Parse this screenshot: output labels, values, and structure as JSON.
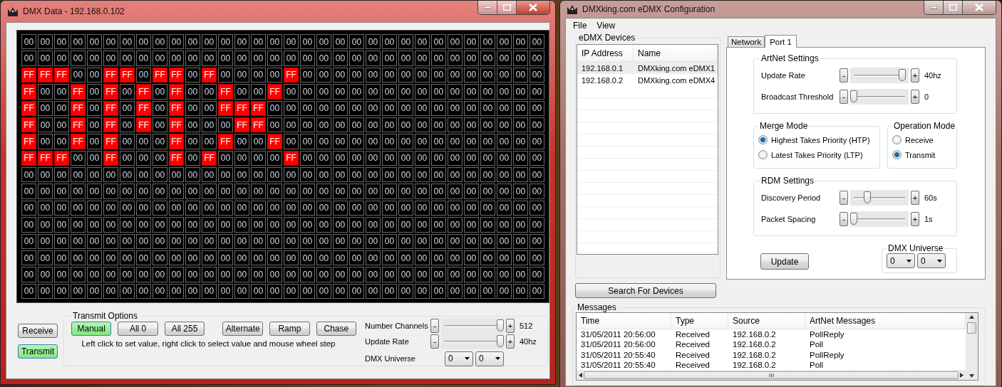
{
  "dmx_window": {
    "title": "DMX Data - 192.168.0.102",
    "grid": {
      "rows": [
        {
          "values": [
            "00",
            "00",
            "00",
            "00",
            "00",
            "00",
            "00",
            "00",
            "00",
            "00",
            "00",
            "00",
            "00",
            "00",
            "00",
            "00",
            "00",
            "00",
            "00",
            "00",
            "00",
            "00",
            "00",
            "00",
            "00",
            "00",
            "00",
            "00",
            "00",
            "00",
            "00",
            "00"
          ],
          "lit": [
            false,
            false,
            false,
            false,
            false,
            false,
            false,
            false,
            false,
            false,
            false,
            false,
            false,
            false,
            false,
            false,
            false,
            false,
            false,
            false,
            false,
            false,
            false,
            false,
            false,
            false,
            false,
            false,
            false,
            false,
            false,
            false
          ]
        },
        {
          "values": [
            "00",
            "00",
            "00",
            "00",
            "00",
            "00",
            "00",
            "00",
            "00",
            "00",
            "00",
            "00",
            "00",
            "00",
            "00",
            "00",
            "00",
            "00",
            "00",
            "00",
            "00",
            "00",
            "00",
            "00",
            "00",
            "00",
            "00",
            "00",
            "00",
            "00",
            "00",
            "00"
          ],
          "lit": [
            false,
            false,
            false,
            false,
            false,
            false,
            false,
            false,
            false,
            false,
            false,
            false,
            false,
            false,
            false,
            false,
            false,
            false,
            false,
            false,
            false,
            false,
            false,
            false,
            false,
            false,
            false,
            false,
            false,
            false,
            false,
            false
          ]
        },
        {
          "values": [
            "FF",
            "FF",
            "FF",
            "00",
            "00",
            "FF",
            "FF",
            "00",
            "FF",
            "FF",
            "00",
            "FF",
            "00",
            "00",
            "00",
            "00",
            "FF",
            "00",
            "00",
            "00",
            "00",
            "00",
            "00",
            "00",
            "00",
            "00",
            "00",
            "00",
            "00",
            "00",
            "00",
            "00"
          ],
          "lit": [
            true,
            true,
            true,
            false,
            false,
            true,
            true,
            false,
            true,
            true,
            false,
            true,
            false,
            false,
            false,
            false,
            true,
            false,
            false,
            false,
            false,
            false,
            false,
            false,
            false,
            false,
            false,
            false,
            false,
            false,
            false,
            false
          ]
        },
        {
          "values": [
            "FF",
            "00",
            "00",
            "FF",
            "00",
            "FF",
            "00",
            "FF",
            "00",
            "FF",
            "00",
            "00",
            "FF",
            "00",
            "00",
            "FF",
            "00",
            "00",
            "00",
            "00",
            "00",
            "00",
            "00",
            "00",
            "00",
            "00",
            "00",
            "00",
            "00",
            "00",
            "00",
            "00"
          ],
          "lit": [
            true,
            false,
            false,
            true,
            false,
            true,
            false,
            true,
            false,
            true,
            false,
            false,
            true,
            false,
            false,
            true,
            false,
            false,
            false,
            false,
            false,
            false,
            false,
            false,
            false,
            false,
            false,
            false,
            false,
            false,
            false,
            false
          ]
        },
        {
          "values": [
            "FF",
            "00",
            "00",
            "FF",
            "00",
            "FF",
            "00",
            "FF",
            "00",
            "FF",
            "00",
            "00",
            "FF",
            "FF",
            "FF",
            "00",
            "00",
            "00",
            "00",
            "00",
            "00",
            "00",
            "00",
            "00",
            "00",
            "00",
            "00",
            "00",
            "00",
            "00",
            "00",
            "00"
          ],
          "lit": [
            true,
            false,
            false,
            true,
            false,
            true,
            false,
            true,
            false,
            true,
            false,
            false,
            true,
            true,
            true,
            false,
            false,
            false,
            false,
            false,
            false,
            false,
            false,
            false,
            false,
            false,
            false,
            false,
            false,
            false,
            false,
            false
          ]
        },
        {
          "values": [
            "FF",
            "00",
            "00",
            "FF",
            "00",
            "FF",
            "00",
            "FF",
            "00",
            "FF",
            "00",
            "00",
            "00",
            "FF",
            "FF",
            "00",
            "00",
            "00",
            "00",
            "00",
            "00",
            "00",
            "00",
            "00",
            "00",
            "00",
            "00",
            "00",
            "00",
            "00",
            "00",
            "00"
          ],
          "lit": [
            true,
            false,
            false,
            true,
            false,
            true,
            false,
            true,
            false,
            true,
            false,
            false,
            false,
            true,
            true,
            false,
            false,
            false,
            false,
            false,
            false,
            false,
            false,
            false,
            false,
            false,
            false,
            false,
            false,
            false,
            false,
            false
          ]
        },
        {
          "values": [
            "FF",
            "00",
            "00",
            "FF",
            "00",
            "FF",
            "00",
            "00",
            "00",
            "FF",
            "00",
            "00",
            "FF",
            "00",
            "00",
            "FF",
            "00",
            "00",
            "00",
            "00",
            "00",
            "00",
            "00",
            "00",
            "00",
            "00",
            "00",
            "00",
            "00",
            "00",
            "00",
            "00"
          ],
          "lit": [
            true,
            false,
            false,
            true,
            false,
            true,
            false,
            false,
            false,
            true,
            false,
            false,
            true,
            false,
            false,
            true,
            false,
            false,
            false,
            false,
            false,
            false,
            false,
            false,
            false,
            false,
            false,
            false,
            false,
            false,
            false,
            false
          ]
        },
        {
          "values": [
            "FF",
            "FF",
            "FF",
            "00",
            "00",
            "FF",
            "00",
            "00",
            "00",
            "FF",
            "00",
            "FF",
            "00",
            "00",
            "00",
            "00",
            "FF",
            "00",
            "00",
            "00",
            "00",
            "00",
            "00",
            "00",
            "00",
            "00",
            "00",
            "00",
            "00",
            "00",
            "00",
            "00"
          ],
          "lit": [
            true,
            true,
            true,
            false,
            false,
            true,
            false,
            false,
            false,
            true,
            false,
            true,
            false,
            false,
            false,
            false,
            true,
            false,
            false,
            false,
            false,
            false,
            false,
            false,
            false,
            false,
            false,
            false,
            false,
            false,
            false,
            false
          ]
        },
        {
          "values": [
            "00",
            "00",
            "00",
            "00",
            "00",
            "00",
            "00",
            "00",
            "00",
            "00",
            "00",
            "00",
            "00",
            "00",
            "00",
            "00",
            "00",
            "00",
            "00",
            "00",
            "00",
            "00",
            "00",
            "00",
            "00",
            "00",
            "00",
            "00",
            "00",
            "00",
            "00",
            "00"
          ],
          "lit": [
            false,
            false,
            false,
            false,
            false,
            false,
            false,
            false,
            false,
            false,
            false,
            false,
            false,
            false,
            false,
            false,
            false,
            false,
            false,
            false,
            false,
            false,
            false,
            false,
            false,
            false,
            false,
            false,
            false,
            false,
            false,
            false
          ]
        },
        {
          "values": [
            "00",
            "00",
            "00",
            "00",
            "00",
            "00",
            "00",
            "00",
            "00",
            "00",
            "00",
            "00",
            "00",
            "00",
            "00",
            "00",
            "00",
            "00",
            "00",
            "00",
            "00",
            "00",
            "00",
            "00",
            "00",
            "00",
            "00",
            "00",
            "00",
            "00",
            "00",
            "00"
          ],
          "lit": [
            false,
            false,
            false,
            false,
            false,
            false,
            false,
            false,
            false,
            false,
            false,
            false,
            false,
            false,
            false,
            false,
            false,
            false,
            false,
            false,
            false,
            false,
            false,
            false,
            false,
            false,
            false,
            false,
            false,
            false,
            false,
            false
          ]
        },
        {
          "values": [
            "00",
            "00",
            "00",
            "00",
            "00",
            "00",
            "00",
            "00",
            "00",
            "00",
            "00",
            "00",
            "00",
            "00",
            "00",
            "00",
            "00",
            "00",
            "00",
            "00",
            "00",
            "00",
            "00",
            "00",
            "00",
            "00",
            "00",
            "00",
            "00",
            "00",
            "00",
            "00"
          ],
          "lit": [
            false,
            false,
            false,
            false,
            false,
            false,
            false,
            false,
            false,
            false,
            false,
            false,
            false,
            false,
            false,
            false,
            false,
            false,
            false,
            false,
            false,
            false,
            false,
            false,
            false,
            false,
            false,
            false,
            false,
            false,
            false,
            false
          ]
        },
        {
          "values": [
            "00",
            "00",
            "00",
            "00",
            "00",
            "00",
            "00",
            "00",
            "00",
            "00",
            "00",
            "00",
            "00",
            "00",
            "00",
            "00",
            "00",
            "00",
            "00",
            "00",
            "00",
            "00",
            "00",
            "00",
            "00",
            "00",
            "00",
            "00",
            "00",
            "00",
            "00",
            "00"
          ],
          "lit": [
            false,
            false,
            false,
            false,
            false,
            false,
            false,
            false,
            false,
            false,
            false,
            false,
            false,
            false,
            false,
            false,
            false,
            false,
            false,
            false,
            false,
            false,
            false,
            false,
            false,
            false,
            false,
            false,
            false,
            false,
            false,
            false
          ]
        },
        {
          "values": [
            "00",
            "00",
            "00",
            "00",
            "00",
            "00",
            "00",
            "00",
            "00",
            "00",
            "00",
            "00",
            "00",
            "00",
            "00",
            "00",
            "00",
            "00",
            "00",
            "00",
            "00",
            "00",
            "00",
            "00",
            "00",
            "00",
            "00",
            "00",
            "00",
            "00",
            "00",
            "00"
          ],
          "lit": [
            false,
            false,
            false,
            false,
            false,
            false,
            false,
            false,
            false,
            false,
            false,
            false,
            false,
            false,
            false,
            false,
            false,
            false,
            false,
            false,
            false,
            false,
            false,
            false,
            false,
            false,
            false,
            false,
            false,
            false,
            false,
            false
          ]
        },
        {
          "values": [
            "00",
            "00",
            "00",
            "00",
            "00",
            "00",
            "00",
            "00",
            "00",
            "00",
            "00",
            "00",
            "00",
            "00",
            "00",
            "00",
            "00",
            "00",
            "00",
            "00",
            "00",
            "00",
            "00",
            "00",
            "00",
            "00",
            "00",
            "00",
            "00",
            "00",
            "00",
            "00"
          ],
          "lit": [
            false,
            false,
            false,
            false,
            false,
            false,
            false,
            false,
            false,
            false,
            false,
            false,
            false,
            false,
            false,
            false,
            false,
            false,
            false,
            false,
            false,
            false,
            false,
            false,
            false,
            false,
            false,
            false,
            false,
            false,
            false,
            false
          ]
        },
        {
          "values": [
            "00",
            "00",
            "00",
            "00",
            "00",
            "00",
            "00",
            "00",
            "00",
            "00",
            "00",
            "00",
            "00",
            "00",
            "00",
            "00",
            "00",
            "00",
            "00",
            "00",
            "00",
            "00",
            "00",
            "00",
            "00",
            "00",
            "00",
            "00",
            "00",
            "00",
            "00",
            "00"
          ],
          "lit": [
            false,
            false,
            false,
            false,
            false,
            false,
            false,
            false,
            false,
            false,
            false,
            false,
            false,
            false,
            false,
            false,
            false,
            false,
            false,
            false,
            false,
            false,
            false,
            false,
            false,
            false,
            false,
            false,
            false,
            false,
            false,
            false
          ]
        },
        {
          "values": [
            "00",
            "00",
            "00",
            "00",
            "00",
            "00",
            "00",
            "00",
            "00",
            "00",
            "00",
            "00",
            "00",
            "00",
            "00",
            "00",
            "00",
            "00",
            "00",
            "00",
            "00",
            "00",
            "00",
            "00",
            "00",
            "00",
            "00",
            "00",
            "00",
            "00",
            "00",
            "00"
          ],
          "lit": [
            false,
            false,
            false,
            false,
            false,
            false,
            false,
            false,
            false,
            false,
            false,
            false,
            false,
            false,
            false,
            false,
            false,
            false,
            false,
            false,
            false,
            false,
            false,
            false,
            false,
            false,
            false,
            false,
            false,
            false,
            false,
            false
          ]
        }
      ]
    },
    "mode_buttons": [
      {
        "label": "Receive",
        "selected": false
      },
      {
        "label": "Transmit",
        "selected": true
      }
    ],
    "transmit_options": {
      "title": "Transmit Options",
      "buttons": [
        {
          "label": "Manual",
          "selected": true
        },
        {
          "label": "All 0",
          "selected": false
        },
        {
          "label": "All 255",
          "selected": false
        },
        {
          "label": "Alternate",
          "selected": false
        },
        {
          "label": "Ramp",
          "selected": false
        },
        {
          "label": "Chase",
          "selected": false
        }
      ],
      "hint": "Left click to set value, right click to select value and mouse wheel step",
      "sliders": [
        {
          "label": "Number Channels",
          "minus": "-",
          "plus": "+",
          "level": 1,
          "reading": "512"
        },
        {
          "label": "Update Rate",
          "minus": "-",
          "plus": "+",
          "level": 1,
          "reading": "40hz"
        }
      ],
      "universe": {
        "label": "DMX Universe",
        "values": [
          "0",
          "0"
        ]
      }
    }
  },
  "config_window": {
    "title": "DMXking.com eDMX Configuration",
    "menu": [
      "File",
      "View"
    ],
    "devices": {
      "title": "eDMX Devices",
      "columns": [
        "IP Address",
        "Name"
      ],
      "rows": [
        {
          "cells": [
            "192.168.0.1",
            "DMXking.com eDMX1"
          ],
          "selected": true
        },
        {
          "cells": [
            "192.168.0.2",
            "DMXking.com eDMX4"
          ],
          "selected": false
        }
      ],
      "search_button": "Search For Devices"
    },
    "tabs": [
      {
        "label": "Network",
        "selected": false
      },
      {
        "label": "Port 1",
        "selected": true
      }
    ],
    "artnet": {
      "title": "ArtNet Settings",
      "sliders": [
        {
          "label": "Update Rate",
          "minus": "-",
          "plus": "+",
          "level": 0.95,
          "reading": "40hz"
        },
        {
          "label": "Broadcast Threshold",
          "minus": "-",
          "plus": "+",
          "level": 0,
          "reading": "0"
        }
      ]
    },
    "merge_mode": {
      "title": "Merge Mode",
      "options": [
        {
          "label": "Highest Takes Priority (HTP)",
          "selected": true
        },
        {
          "label": "Latest Takes Priority (LTP)",
          "selected": false
        }
      ]
    },
    "operation_mode": {
      "title": "Operation Mode",
      "options": [
        {
          "label": "Receive",
          "selected": false
        },
        {
          "label": "Transmit",
          "selected": true
        }
      ]
    },
    "rdm": {
      "title": "RDM Settings",
      "sliders": [
        {
          "label": "Discovery Period",
          "minus": "-",
          "plus": "+",
          "level": 0.27,
          "reading": "60s"
        },
        {
          "label": "Packet Spacing",
          "minus": "-",
          "plus": "+",
          "level": 0,
          "reading": "1s"
        }
      ]
    },
    "update_button": "Update",
    "universe": {
      "title": "DMX Universe",
      "values": [
        "0",
        "0"
      ]
    },
    "messages": {
      "title": "Messages",
      "columns": [
        "Time",
        "Type",
        "Source",
        "ArtNet Messages"
      ],
      "rows": [
        [
          "31/05/2011 20:56:00",
          "Received",
          "192.168.0.2",
          "PollReply"
        ],
        [
          "31/05/2011 20:56:00",
          "Received",
          "192.168.0.2",
          "Poll"
        ],
        [
          "31/05/2011 20:55:40",
          "Received",
          "192.168.0.2",
          "PollReply"
        ],
        [
          "31/05/2011 20:55:40",
          "Received",
          "192.168.0.2",
          "Poll"
        ]
      ]
    }
  }
}
